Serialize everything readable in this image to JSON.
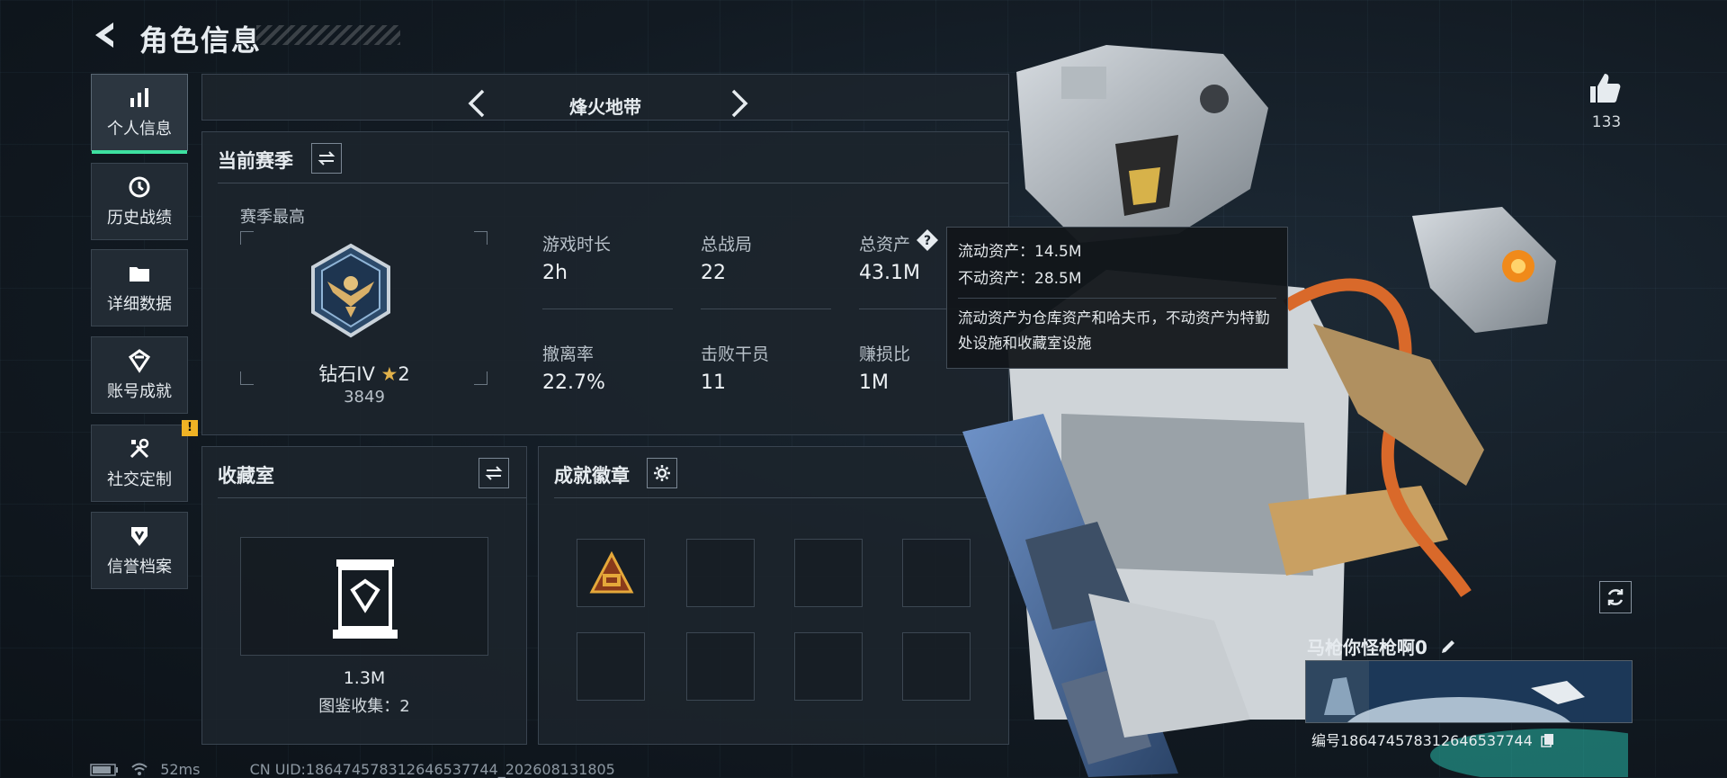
{
  "header": {
    "title": "角色信息"
  },
  "nav": {
    "items": [
      {
        "label": "个人信息",
        "icon": "bar-chart-icon",
        "active": true
      },
      {
        "label": "历史战绩",
        "icon": "history-icon"
      },
      {
        "label": "详细数据",
        "icon": "folder-icon"
      },
      {
        "label": "账号成就",
        "icon": "achievement-icon"
      },
      {
        "label": "社交定制",
        "icon": "tools-icon",
        "badge": "!"
      },
      {
        "label": "信誉档案",
        "icon": "shield-icon"
      }
    ]
  },
  "mode": {
    "name": "烽火地带"
  },
  "season": {
    "title": "当前赛季",
    "best_label": "赛季最高",
    "rank_name": "钻石IV",
    "rank_stars": "2",
    "rank_score": "3849",
    "stats": [
      {
        "label": "游戏时长",
        "value": "2h"
      },
      {
        "label": "总战局",
        "value": "22"
      },
      {
        "label": "总资产",
        "value": "43.1M"
      },
      {
        "label": "撤离率",
        "value": "22.7%"
      },
      {
        "label": "击败干员",
        "value": "11"
      },
      {
        "label": "赚损比",
        "value": "1M"
      }
    ]
  },
  "tooltip": {
    "liquid": "流动资产：14.5M",
    "fixed": "不动资产：28.5M",
    "desc": "流动资产为仓库资产和哈夫币，不动资产为特勤处设施和收藏室设施"
  },
  "collection": {
    "title": "收藏室",
    "value": "1.3M",
    "count_text": "图鉴收集：2"
  },
  "badges": {
    "title": "成就徽章"
  },
  "player": {
    "likes": "133",
    "name": "马枪你怪枪啊0",
    "id_text": "编号1864745783126465377​44"
  },
  "status": {
    "ping": "52ms",
    "uid": "CN UID:186474578312646537744_202608131805"
  },
  "colors": {
    "accent": "#3ee0a0",
    "badge": "#f0b325",
    "panel": "#1c242c"
  }
}
